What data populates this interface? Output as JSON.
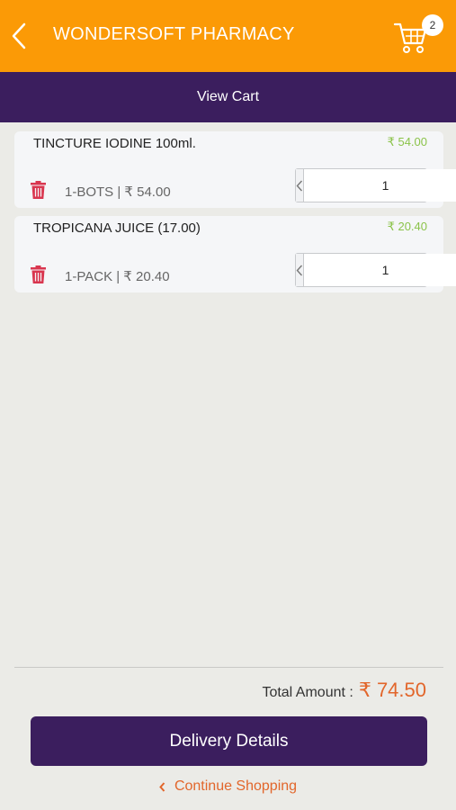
{
  "header": {
    "title": "WONDERSOFT PHARMACY",
    "cart_count": "2",
    "back_icon": "chevron-left-icon",
    "cart_icon": "shopping-cart-icon"
  },
  "sub_header": {
    "title": "View Cart"
  },
  "cart_items": [
    {
      "name": "TINCTURE IODINE 100ml.",
      "price": "₹ 54.00",
      "unit_line": "1-BOTS | ₹ 54.00",
      "quantity": "1"
    },
    {
      "name": "TROPICANA JUICE (17.00)",
      "price": "₹ 20.40",
      "unit_line": "1-PACK | ₹ 20.40",
      "quantity": "1"
    }
  ],
  "summary": {
    "total_label": "Total Amount :",
    "total_value": "₹ 74.50"
  },
  "actions": {
    "delivery_label": "Delivery Details",
    "continue_label": "Continue Shopping"
  },
  "colors": {
    "header_bg": "#fb9a06",
    "brand_purple": "#3b1e5e",
    "price_green": "#8bc34a",
    "accent_orange": "#e2662b",
    "delete_red": "#d9364f"
  }
}
